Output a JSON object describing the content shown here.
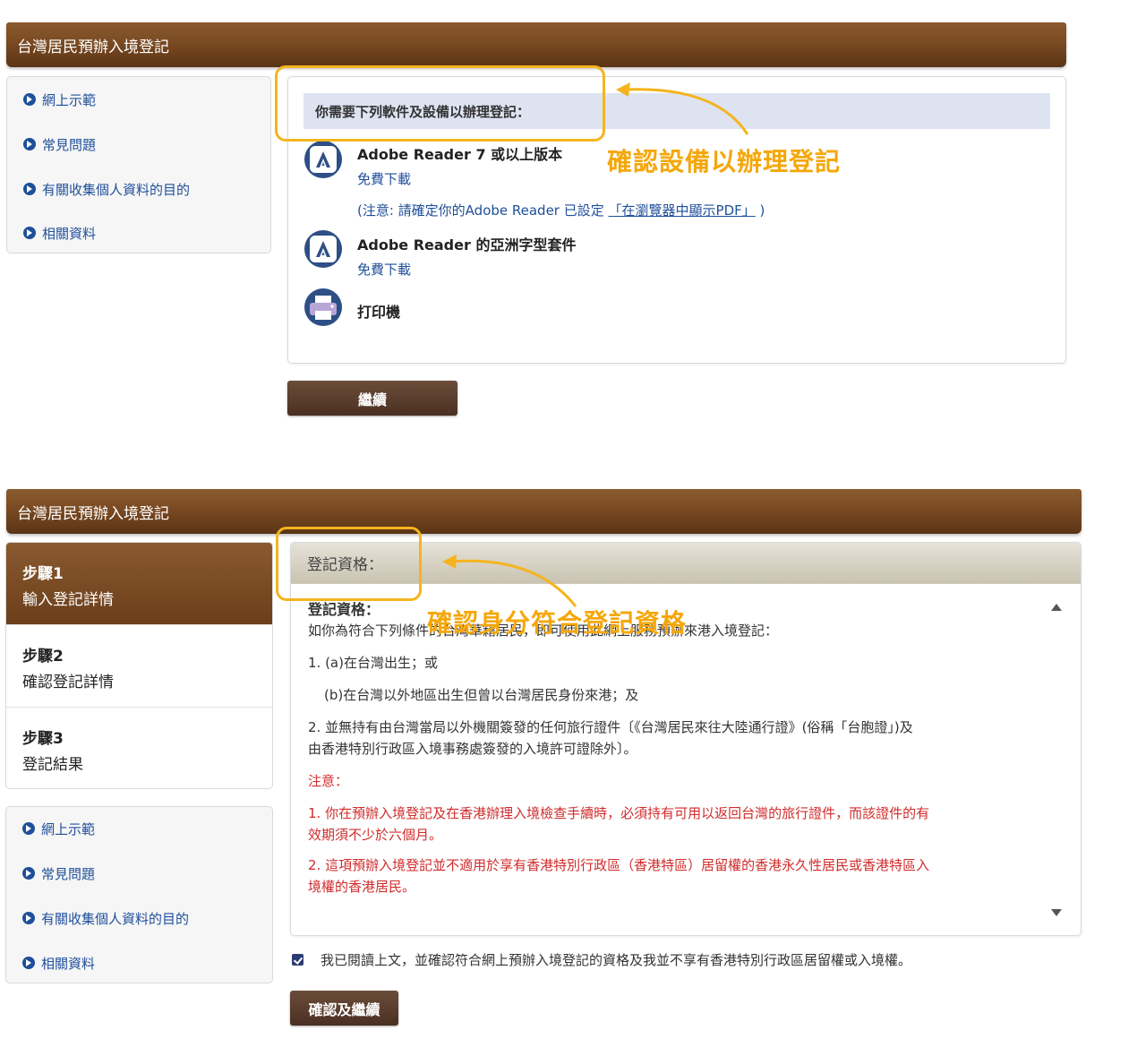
{
  "section1": {
    "header": "台灣居民預辦入境登記",
    "sidebar": [
      "網上示範",
      "常見問題",
      "有關收集個人資料的目的",
      "相關資料"
    ],
    "requirements_title": "你需要下列軟件及設備以辦理登記：",
    "item1_name": "Adobe Reader 7 或以上版本",
    "item1_link": "免費下載",
    "note_prefix": "(注意: 請確定你的Adobe Reader 已設定",
    "note_link": "「在瀏覽器中顯示PDF」",
    "note_suffix": ")",
    "item2_name": "Adobe Reader 的亞洲字型套件",
    "item2_link": "免費下載",
    "item3_name": "打印機",
    "continue_button": "繼續",
    "annotation": "確認設備以辦理登記"
  },
  "section2": {
    "header": "台灣居民預辦入境登記",
    "steps": [
      {
        "num": "步驟1",
        "label": "輸入登記詳情"
      },
      {
        "num": "步驟2",
        "label": "確認登記詳情"
      },
      {
        "num": "步驟3",
        "label": "登記結果"
      }
    ],
    "sidebar": [
      "網上示範",
      "常見問題",
      "有關收集個人資料的目的",
      "相關資料"
    ],
    "panel_title": "登記資格：",
    "body_title": "登記資格：",
    "intro": "如你為符合下列條件的台灣華籍居民，即可使用此網上服務預辦來港入境登記：",
    "cond1a": "1. (a)在台灣出生；或",
    "cond1b": "(b)在台灣以外地區出生但曾以台灣居民身份來港；及",
    "cond2_line1": "2. 並無持有由台灣當局以外機關簽發的任何旅行證件〔《台灣居民來往大陸通行證》(俗稱「台胞證」)及",
    "cond2_line2": "由香港特別行政區入境事務處簽發的入境許可證除外〕。",
    "note_title": "注意：",
    "note1_line1": "1. 你在預辦入境登記及在香港辦理入境檢查手續時，必須持有可用以返回台灣的旅行證件，而該證件的有",
    "note1_line2": "效期須不少於六個月。",
    "note2_line1": "2. 這項預辦入境登記並不適用於享有香港特別行政區（香港特區）居留權的香港永久性居民或香港特區入",
    "note2_line2": "境權的香港居民。",
    "agree_text": "我已閱讀上文，並確認符合網上預辦入境登記的資格及我並不享有香港特別行政區居留權或入境權。",
    "confirm_button": "確認及繼續",
    "annotation": "確認身分符合登記資格"
  },
  "colors": {
    "header_brown": "#7a4a22",
    "link_blue": "#1f4f9a",
    "annotation_orange": "#f5a70a",
    "warning_red": "#d12b2b"
  }
}
